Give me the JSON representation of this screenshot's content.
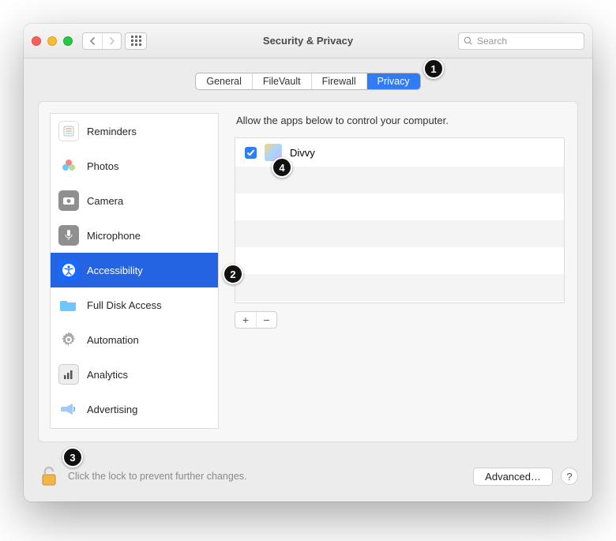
{
  "window": {
    "title": "Security & Privacy"
  },
  "toolbar": {
    "search_placeholder": "Search"
  },
  "tabs": [
    {
      "label": "General"
    },
    {
      "label": "FileVault"
    },
    {
      "label": "Firewall"
    },
    {
      "label": "Privacy",
      "active": true
    }
  ],
  "sidebar": {
    "items": [
      {
        "label": "Reminders",
        "icon": "reminders-icon"
      },
      {
        "label": "Photos",
        "icon": "photos-icon"
      },
      {
        "label": "Camera",
        "icon": "camera-icon"
      },
      {
        "label": "Microphone",
        "icon": "microphone-icon"
      },
      {
        "label": "Accessibility",
        "icon": "accessibility-icon",
        "selected": true
      },
      {
        "label": "Full Disk Access",
        "icon": "folder-icon"
      },
      {
        "label": "Automation",
        "icon": "gear-icon"
      },
      {
        "label": "Analytics",
        "icon": "chart-icon"
      },
      {
        "label": "Advertising",
        "icon": "megaphone-icon"
      }
    ]
  },
  "detail": {
    "instruction": "Allow the apps below to control your computer.",
    "apps": [
      {
        "name": "Divvy",
        "checked": true
      }
    ],
    "add_label": "+",
    "remove_label": "−"
  },
  "footer": {
    "lock_text": "Click the lock to prevent further changes.",
    "advanced_label": "Advanced…",
    "help_label": "?"
  },
  "callouts": {
    "c1": "1",
    "c2": "2",
    "c3": "3",
    "c4": "4"
  }
}
